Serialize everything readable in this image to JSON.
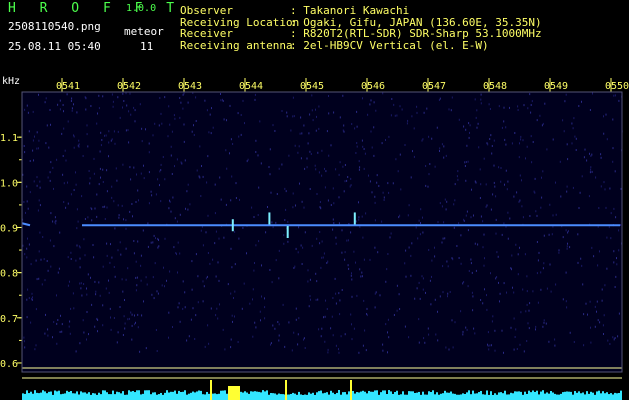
{
  "header": {
    "logo": "H R O F F T",
    "version": "1.0.0",
    "filename": "2508110540.png",
    "datetime": "25.08.11 05:40",
    "meteor_label": "meteor",
    "meteor_count": "11"
  },
  "info": [
    {
      "key": "Observer",
      "value": ": Takanori Kawachi"
    },
    {
      "key": "Receiving Location",
      "value": ": Ogaki, Gifu, JAPAN (136.60E, 35.35N)"
    },
    {
      "key": "Receiver",
      "value": ": R820T2(RTL-SDR) SDR-Sharp 53.1000MHz"
    },
    {
      "key": "Receiving antenna",
      "value": ": 2el-HB9CV Vertical (el. E-W)"
    }
  ],
  "chart_data": {
    "type": "heatmap",
    "ylabel": "kHz",
    "x_ticks": [
      "0541",
      "0542",
      "0543",
      "0544",
      "0545",
      "0546",
      "0547",
      "0548",
      "0549",
      "0550"
    ],
    "y_ticks": [
      "1.1",
      "1.0",
      "0.9",
      "0.8",
      "0.7",
      "0.6"
    ],
    "ylim": [
      0.58,
      1.2
    ],
    "carrier_khz": 0.905,
    "meteor_echoes": [
      {
        "time": "0543.8",
        "khz": 0.905
      },
      {
        "time": "0544.4",
        "khz": 0.92
      },
      {
        "time": "0544.7",
        "khz": 0.89
      },
      {
        "time": "0545.8",
        "khz": 0.92
      }
    ],
    "colors": {
      "background": "#00001e",
      "carrier": "#4b8cff",
      "echo": "#7cf0ff",
      "signal_strip": "#33e6ff",
      "ticks": "#ffff66"
    }
  }
}
